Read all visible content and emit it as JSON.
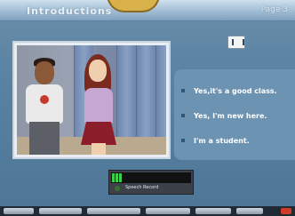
{
  "header": {
    "lesson_title": "Introductions",
    "page_indicator": "Page 3"
  },
  "options": [
    {
      "label": "Yes,it's a good class."
    },
    {
      "label": "Yes, I'm new here."
    },
    {
      "label": "I'm a student."
    }
  ],
  "recorder": {
    "label": "Speech Record",
    "level": 0.15
  },
  "colors": {
    "panel": "#6d93b3",
    "meter_fill": "#3bd24a"
  }
}
